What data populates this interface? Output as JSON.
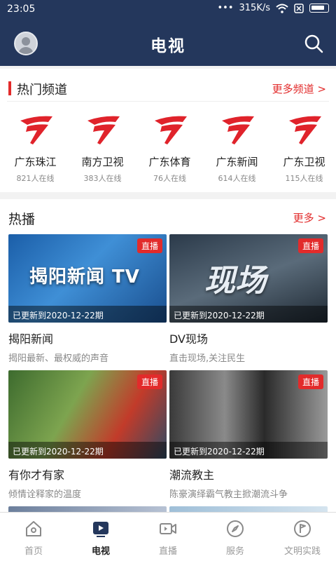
{
  "status": {
    "time": "23:05",
    "speed": "315K/s"
  },
  "header": {
    "title": "电视"
  },
  "hot_channels": {
    "title": "热门频道",
    "more": "更多频道 >",
    "items": [
      {
        "name": "广东珠江",
        "online": "821人在线"
      },
      {
        "name": "南方卫视",
        "online": "383人在线"
      },
      {
        "name": "广东体育",
        "online": "76人在线"
      },
      {
        "name": "广东新闻",
        "online": "614人在线"
      },
      {
        "name": "广东卫视",
        "online": "115人在线"
      }
    ]
  },
  "hot": {
    "title": "热播",
    "more": "更多 >",
    "items": [
      {
        "title": "揭阳新闻",
        "desc": "揭阳最新、最权威的声音",
        "updated": "已更新到2020-12-22期",
        "badge": "直播",
        "overlay": "揭阳新闻 TV"
      },
      {
        "title": "DV现场",
        "desc": "直击现场,关注民生",
        "updated": "已更新到2020-12-22期",
        "badge": "直播",
        "overlay": "现场"
      },
      {
        "title": "有你才有家",
        "desc": "倾情诠释家的温度",
        "updated": "已更新到2020-12-22期",
        "badge": "直播",
        "overlay": ""
      },
      {
        "title": "潮流教主",
        "desc": "陈豪演绎霸气教主掀潮流斗争",
        "updated": "已更新到2020-12-22期",
        "badge": "直播",
        "overlay": ""
      }
    ]
  },
  "tabs": [
    {
      "label": "首页",
      "icon": "home-icon"
    },
    {
      "label": "电视",
      "icon": "tv-icon",
      "active": true
    },
    {
      "label": "直播",
      "icon": "video-camera-icon"
    },
    {
      "label": "服务",
      "icon": "compass-icon"
    },
    {
      "label": "文明实践",
      "icon": "flag-icon"
    }
  ],
  "colors": {
    "header": "#24375c",
    "accent": "#e22b2b"
  }
}
